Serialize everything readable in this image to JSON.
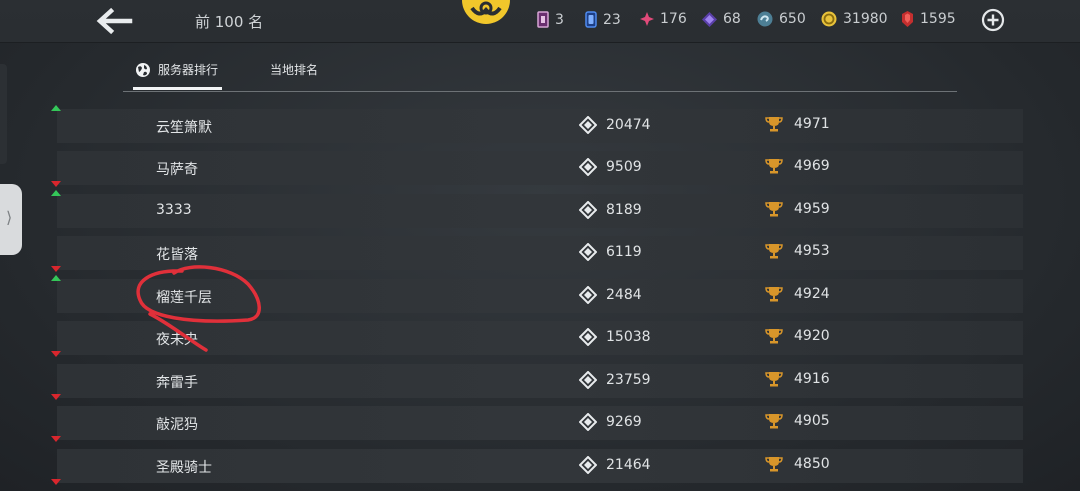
{
  "header": {
    "title": "前 100 名"
  },
  "currencies": [
    {
      "icon": "ticket-icon",
      "value": "3",
      "color": "#d8a6d6"
    },
    {
      "icon": "card-icon",
      "value": "23",
      "color": "#4f8cf0"
    },
    {
      "icon": "diamond-cross-icon",
      "value": "176",
      "color": "#e24a7a"
    },
    {
      "icon": "purple-diamond-icon",
      "value": "68",
      "color": "#8c6fe0"
    },
    {
      "icon": "swirl-coin-icon",
      "value": "650",
      "color": "#8fbcd0"
    },
    {
      "icon": "gold-coin-icon",
      "value": "31980",
      "color": "#e9c33a"
    },
    {
      "icon": "ruby-icon",
      "value": "1595",
      "color": "#d23b3b"
    }
  ],
  "tabs": [
    {
      "label": "服务器排行",
      "active": true
    },
    {
      "label": "当地排名",
      "active": false
    }
  ],
  "rows": [
    {
      "name": "云笙箫默",
      "trend": "up",
      "score": "20474",
      "trophies": "4971"
    },
    {
      "name": "马萨奇",
      "trend": "down",
      "score": "9509",
      "trophies": "4969"
    },
    {
      "name": "3333",
      "trend": "up",
      "score": "8189",
      "trophies": "4959"
    },
    {
      "name": "花皆落",
      "trend": "down",
      "score": "6119",
      "trophies": "4953"
    },
    {
      "name": "榴莲千层",
      "trend": "up",
      "score": "2484",
      "trophies": "4924"
    },
    {
      "name": "夜未央",
      "trend": "down",
      "score": "15038",
      "trophies": "4920"
    },
    {
      "name": "奔雷手",
      "trend": "down",
      "score": "23759",
      "trophies": "4916"
    },
    {
      "name": "敲泥犸",
      "trend": "down",
      "score": "9269",
      "trophies": "4905"
    },
    {
      "name": "圣殿骑士",
      "trend": "down",
      "score": "21464",
      "trophies": "4850"
    }
  ],
  "colors": {
    "trend_up": "#34c759",
    "trend_down": "#d9262d",
    "trophy": "#d8962a",
    "annotation": "#e0303a"
  }
}
